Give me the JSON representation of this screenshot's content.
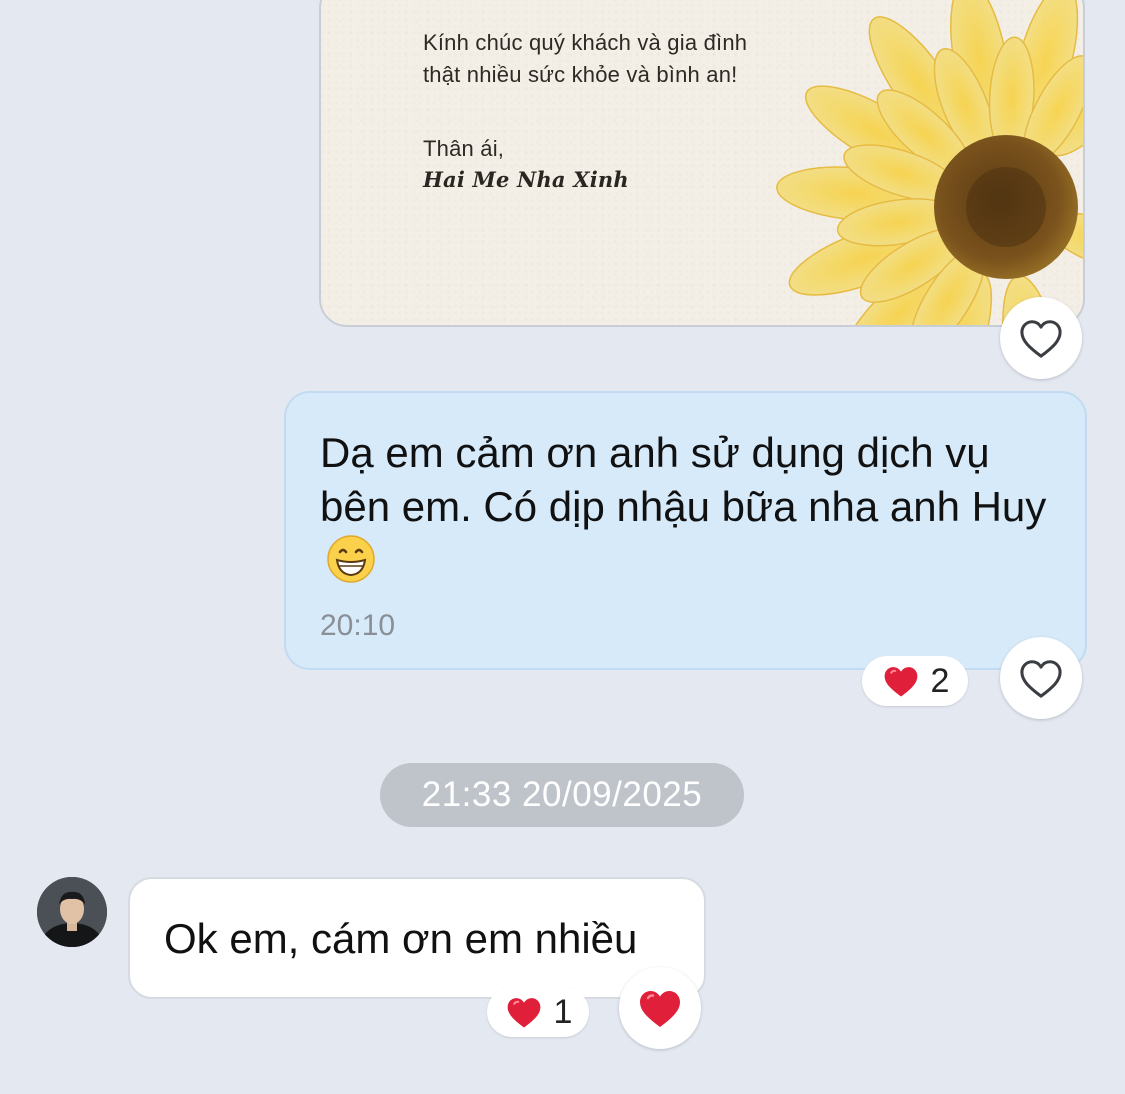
{
  "card": {
    "line1": "Kính chúc quý khách và gia đình",
    "line2": "thật nhiều sức khỏe và bình an!",
    "greeting": "Thân ái,",
    "signature": "Hai Me Nha Xinh"
  },
  "outgoing": {
    "text": "Dạ em cảm ơn anh sử dụng dịch vụ bên em. Có dịp nhậu bữa nha anh Huy",
    "emoji": "grinning-face",
    "time": "20:10",
    "reaction_count": "2"
  },
  "date_separator": "21:33 20/09/2025",
  "incoming": {
    "text": "Ok em, cám ơn em nhiều",
    "reaction_count": "1"
  },
  "colors": {
    "background": "#e3e8f1",
    "outgoing_bubble": "#d6eafa",
    "incoming_bubble": "#ffffff",
    "heart": "#e0203a",
    "date_pill": "#bfc4cb"
  },
  "icons": {
    "like_empty": "heart-outline-icon",
    "like_filled": "heart-filled-icon"
  }
}
